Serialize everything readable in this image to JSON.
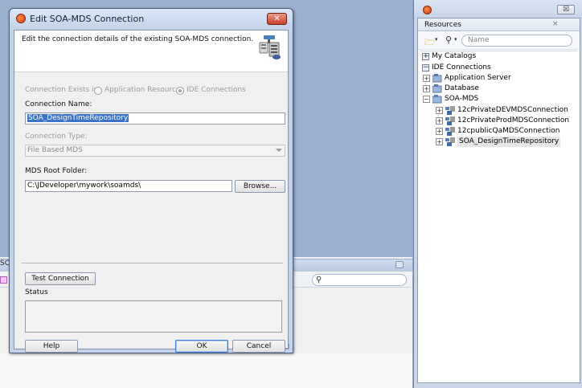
{
  "dialog": {
    "title": "Edit SOA-MDS Connection",
    "description": "Edit the connection details of the existing SOA-MDS connection.",
    "connection_exists_in_label": "Connection Exists in:",
    "radio_app_resources": "Application Resources",
    "radio_ide_connections": "IDE Connections",
    "connection_name_label": "Connection Name:",
    "connection_name_value": "SOA_DesignTimeRepository",
    "connection_type_label": "Connection Type:",
    "connection_type_value": "File Based MDS",
    "mds_root_label": "MDS Root Folder:",
    "mds_root_value": "C:\\JDeveloper\\mywork\\soamds\\",
    "browse_label": "Browse...",
    "test_connection_label": "Test Connection",
    "status_label": "Status",
    "help_label": "Help",
    "ok_label": "OK",
    "cancel_label": "Cancel",
    "close_glyph": "✕"
  },
  "resources": {
    "title": "Resources",
    "close_glyph": "×",
    "search_placeholder": "Name",
    "tree": [
      {
        "label": "My Catalogs",
        "level": 0,
        "expander": "+"
      },
      {
        "label": "IDE Connections",
        "level": 0,
        "expander": "−"
      },
      {
        "label": "Application Server",
        "level": 1,
        "expander": "+"
      },
      {
        "label": "Database",
        "level": 1,
        "expander": "+"
      },
      {
        "label": "SOA-MDS",
        "level": 1,
        "expander": "−"
      },
      {
        "label": "12cPrivateDEVMDSConnection",
        "level": 2,
        "expander": "+"
      },
      {
        "label": "12cPrivateProdMDSConnection",
        "level": 2,
        "expander": "+"
      },
      {
        "label": "12cpublicQaMDSConnection",
        "level": 2,
        "expander": "+"
      },
      {
        "label": "SOA_DesignTimeRepository",
        "level": 2,
        "expander": "+",
        "selected": true
      }
    ]
  },
  "background": {
    "left_tab_text": "SOA"
  },
  "colors": {
    "selection": "#3b73c7",
    "dialog_frame": "#c3d3e8",
    "close_button": "#c84027"
  }
}
